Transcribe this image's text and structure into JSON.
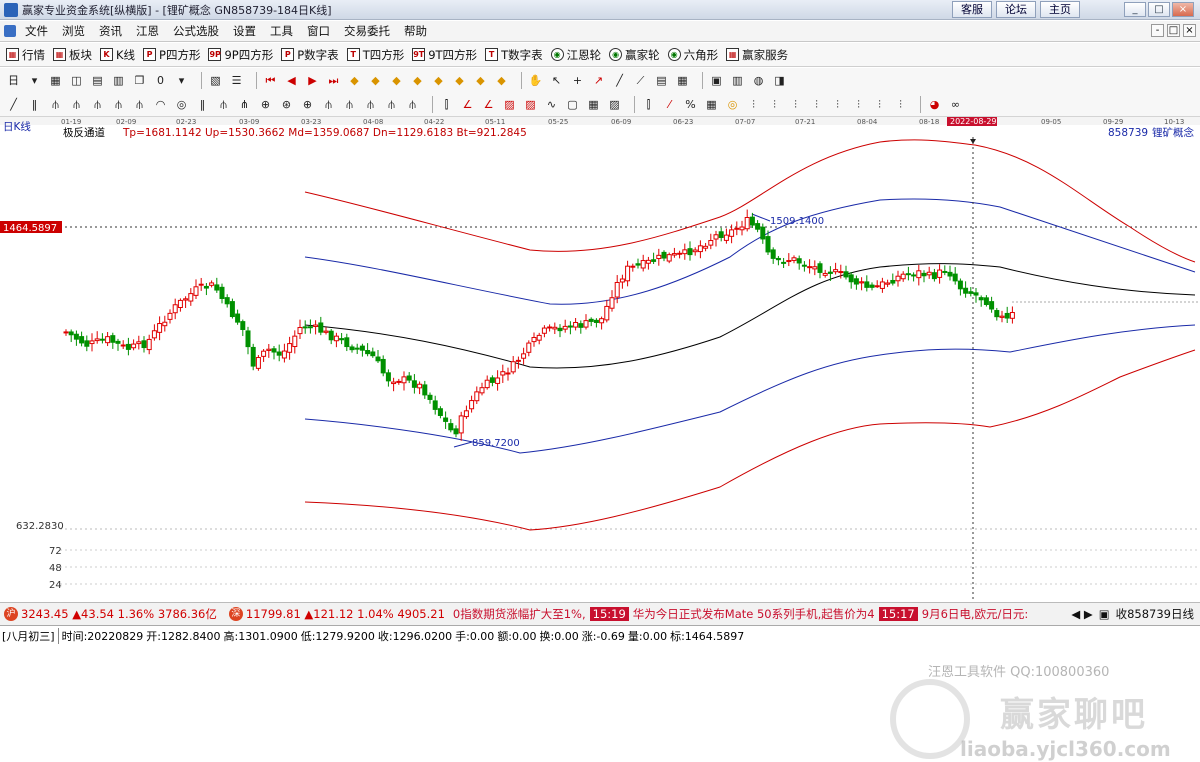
{
  "window": {
    "title": "赢家专业资金系统[纵横版] - [锂矿概念 GN858739-184日K线]",
    "links": [
      "客服",
      "论坛",
      "主页"
    ],
    "controls": [
      "_",
      "□",
      "×"
    ]
  },
  "menu": {
    "items": [
      "文件",
      "浏览",
      "资讯",
      "江恩",
      "公式选股",
      "设置",
      "工具",
      "窗口",
      "交易委托",
      "帮助"
    ],
    "mdi_controls": [
      "-",
      "□",
      "×"
    ]
  },
  "nav": {
    "items": [
      {
        "label": "行情",
        "icon": "grid"
      },
      {
        "label": "板块",
        "icon": "grid"
      },
      {
        "label": "K线",
        "icon": "K"
      },
      {
        "label": "P四方形",
        "icon": "P"
      },
      {
        "label": "9P四方形",
        "icon": "9P"
      },
      {
        "label": "P数字表",
        "icon": "P"
      },
      {
        "label": "T四方形",
        "icon": "T"
      },
      {
        "label": "9T四方形",
        "icon": "9T"
      },
      {
        "label": "T数字表",
        "icon": "T"
      },
      {
        "label": "江恩轮",
        "icon": "wheel"
      },
      {
        "label": "赢家轮",
        "icon": "wheel"
      },
      {
        "label": "六角形",
        "icon": "wheel"
      },
      {
        "label": "赢家服务",
        "icon": "grid"
      }
    ]
  },
  "chart": {
    "period_label": "日K线",
    "indicator_name": "极反通道",
    "indicator_values": "Tp=1681.1142  Up=1530.3662  Md=1359.0687  Dn=1129.6183  Bt=921.2845",
    "stock_code": "858739",
    "stock_name": "锂矿概念",
    "price_marker": "1464.5897",
    "low_axis_label": "632.2830",
    "volume_ticks": [
      "72",
      "48",
      "24"
    ],
    "high_annotation": "1509.1400",
    "low_annotation": "859.7200",
    "selected_date": "2022-08-29",
    "date_ticks": [
      "01-19",
      "02-09",
      "02-23",
      "03-09",
      "03-23",
      "04-08",
      "04-22",
      "05-11",
      "05-25",
      "06-09",
      "06-23",
      "07-07",
      "07-21",
      "08-04",
      "08-18",
      "09-05",
      "09-29",
      "10-13"
    ],
    "colors": {
      "up": "#e00000",
      "down": "#009000",
      "outer_band": "#cc0000",
      "inner_band": "#1a2aa8",
      "mid_line": "#000000",
      "date_highlight": "#c8102e"
    }
  },
  "chart_data": {
    "type": "candlestick",
    "title": "极反通道",
    "series": [
      {
        "name": "Tp",
        "last": 1681.1142
      },
      {
        "name": "Up",
        "last": 1530.3662
      },
      {
        "name": "Md",
        "last": 1359.0687
      },
      {
        "name": "Dn",
        "last": 1129.6183
      },
      {
        "name": "Bt",
        "last": 921.2845
      }
    ],
    "annotations": {
      "high": 1509.14,
      "low": 859.72,
      "reference_price": 1464.5897
    },
    "selected_bar": {
      "date": "20220829",
      "open": 1282.84,
      "high": 1301.09,
      "low": 1279.92,
      "close": 1296.02
    }
  },
  "ticker": {
    "index1": {
      "badge": "沪",
      "text": "3243.45 ▲43.54 1.36% 3786.36亿"
    },
    "index2": {
      "badge": "深",
      "text": "11799.81 ▲121.12 1.04% 4905.21"
    },
    "news": [
      {
        "time": "",
        "text": "0指数期货涨幅扩大至1%,"
      },
      {
        "time": "15:19",
        "text": "华为今日正式发布Mate 50系列手机,起售价为4"
      },
      {
        "time": "15:17",
        "text": "9月6日电,欧元/日元:"
      }
    ],
    "right_text": "收858739日线"
  },
  "bottom": {
    "lunar": "[八月初三]",
    "time": "时间:20220829",
    "open": "开:1282.8400",
    "high": "高:1301.0900",
    "low": "低:1279.9200",
    "close": "收:1296.0200",
    "hand": "手:0.00",
    "amount": "额:0.00",
    "turnover": "换:0.00",
    "change": "涨:-0.69",
    "volume": "量:0.00",
    "mark": "标:1464.5897"
  },
  "watermark": {
    "line1": "汪恩工具软件  QQ:100800360",
    "brand": "赢家聊吧",
    "url": "liaoba.yjcl360.com"
  }
}
